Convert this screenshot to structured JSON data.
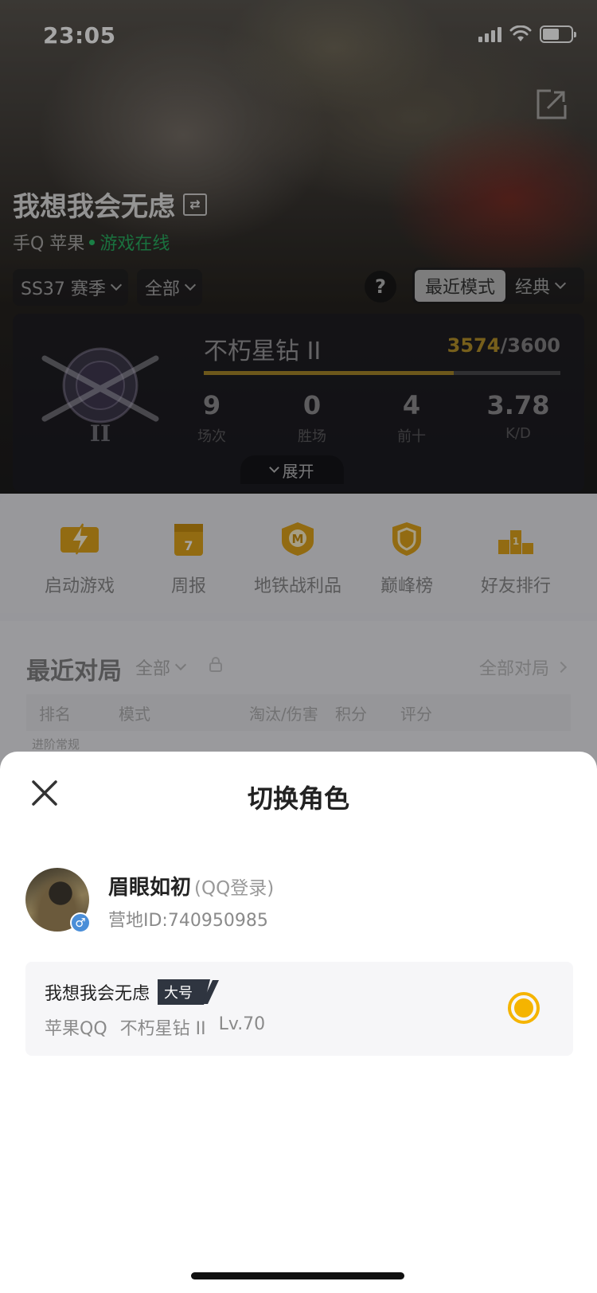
{
  "status_bar": {
    "time": "23:05"
  },
  "header": {
    "player_name": "我想我会无虑",
    "platform": "手Q 苹果",
    "online_status": "游戏在线"
  },
  "filters": {
    "season": "SS37 赛季",
    "scope": "全部",
    "help": "?",
    "mode_active": "最近模式",
    "mode_other": "经典"
  },
  "rank": {
    "title": "不朽星钻 II",
    "score_current": "3574",
    "score_total": "/3600",
    "progress": 0.7,
    "stats": [
      {
        "value": "9",
        "label": "场次"
      },
      {
        "value": "0",
        "label": "胜场"
      },
      {
        "value": "4",
        "label": "前十"
      },
      {
        "value": "3.78",
        "label": "K/D"
      }
    ],
    "expand_label": "展开"
  },
  "actions": [
    {
      "label": "启动游戏",
      "icon": "lightning-icon"
    },
    {
      "label": "周报",
      "icon": "calendar-icon"
    },
    {
      "label": "地铁战利品",
      "icon": "metro-badge-icon"
    },
    {
      "label": "巅峰榜",
      "icon": "peak-shield-icon"
    },
    {
      "label": "好友排行",
      "icon": "podium-icon"
    }
  ],
  "recent": {
    "title": "最近对局",
    "filter": "全部",
    "all_link": "全部对局",
    "columns": [
      "排名",
      "模式",
      "淘汰/伤害",
      "积分",
      "评分"
    ],
    "row_tag": "进阶常规"
  },
  "sheet": {
    "title": "切换角色",
    "account": {
      "name": "眉眼如初",
      "login": "(QQ登录)",
      "id": "营地ID:740950985",
      "gender": "♂"
    },
    "role": {
      "name": "我想我会无虑",
      "tag": "大号",
      "platform": "苹果QQ",
      "rank": "不朽星钻 II",
      "level": "Lv.70",
      "selected": true
    }
  },
  "colors": {
    "accent_gold": "#f5b400",
    "online_green": "#28c46a",
    "rank_gold": "#b7932a"
  }
}
